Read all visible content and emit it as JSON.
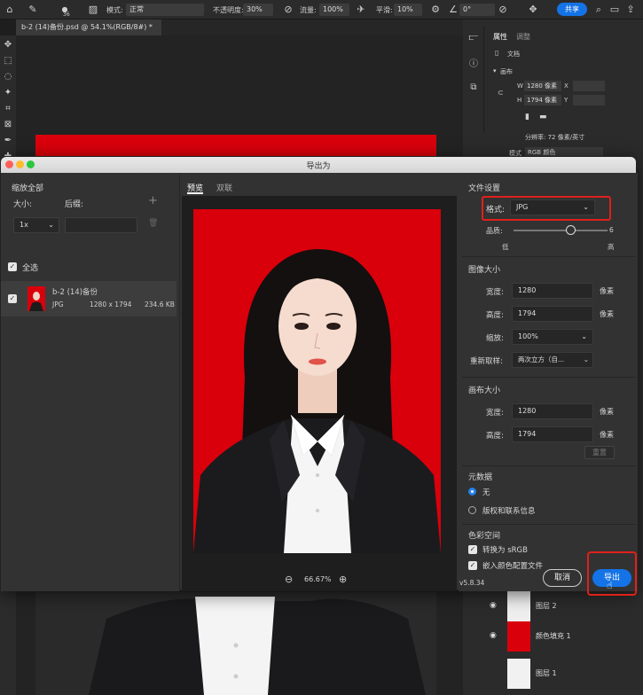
{
  "topbar": {
    "brush_size": "36",
    "mode_label": "模式:",
    "mode_value": "正常",
    "opacity_label": "不透明度:",
    "opacity_value": "30%",
    "flow_label": "流量:",
    "flow_value": "100%",
    "smoothing_label": "平滑:",
    "smoothing_value": "10%",
    "angle_value": "0°",
    "share_label": "共享"
  },
  "document": {
    "tab_title": "b-2 (14)备份.psd @ 54.1%(RGB/8#) *"
  },
  "properties_panel": {
    "tab_properties": "属性",
    "tab_adjustments": "调整",
    "doc_label": "文档",
    "canvas_section": "画布",
    "w_label": "W",
    "w_value": "1280 像素",
    "x_label": "X",
    "h_label": "H",
    "h_value": "1794 像素",
    "y_label": "Y",
    "resolution": "分辨率: 72 像素/英寸",
    "mode_label": "模式",
    "mode_value": "RGB 颜色"
  },
  "layers": [
    {
      "name": "图层 2"
    },
    {
      "name": "颜色填充 1"
    },
    {
      "name": "图层 1"
    }
  ],
  "dialog": {
    "title": "导出为",
    "left": {
      "scale_all": "缩放全部",
      "size_label": "大小:",
      "suffix_label": "后缀:",
      "scale_value": "1x",
      "select_all": "全选",
      "asset_name": "b-2 (14)备份",
      "asset_format": "JPG",
      "asset_dims": "1280 x 1794",
      "asset_size": "234.6 KB"
    },
    "preview": {
      "tab_preview": "预览",
      "tab_dual": "双联",
      "zoom": "66.67%"
    },
    "right": {
      "file_settings": "文件设置",
      "format_label": "格式:",
      "format_value": "JPG",
      "quality_label": "品质:",
      "quality_value": "6",
      "quality_low": "低",
      "quality_high": "高",
      "quality_level": 0.6,
      "image_size": "图像大小",
      "width_label": "宽度:",
      "width_value": "1280",
      "height_label": "高度:",
      "height_value": "1794",
      "unit": "像素",
      "scale_label": "缩放:",
      "scale_value": "100%",
      "resample_label": "重新取样:",
      "resample_value": "两次立方（自...",
      "canvas_size": "画布大小",
      "canvas_width_value": "1280",
      "canvas_height_value": "1794",
      "reset_label": "重置",
      "metadata": "元数据",
      "meta_none": "无",
      "meta_copyright": "版权和联系信息",
      "color_space": "色彩空间",
      "convert_srgb": "转换为 sRGB",
      "embed_profile": "嵌入颜色配置文件",
      "version": "v5.8.34",
      "cancel": "取消",
      "export": "导出"
    }
  },
  "colors": {
    "red_background": "#d9000b",
    "accent_blue": "#1473e6",
    "highlight_red": "#e0201a"
  }
}
